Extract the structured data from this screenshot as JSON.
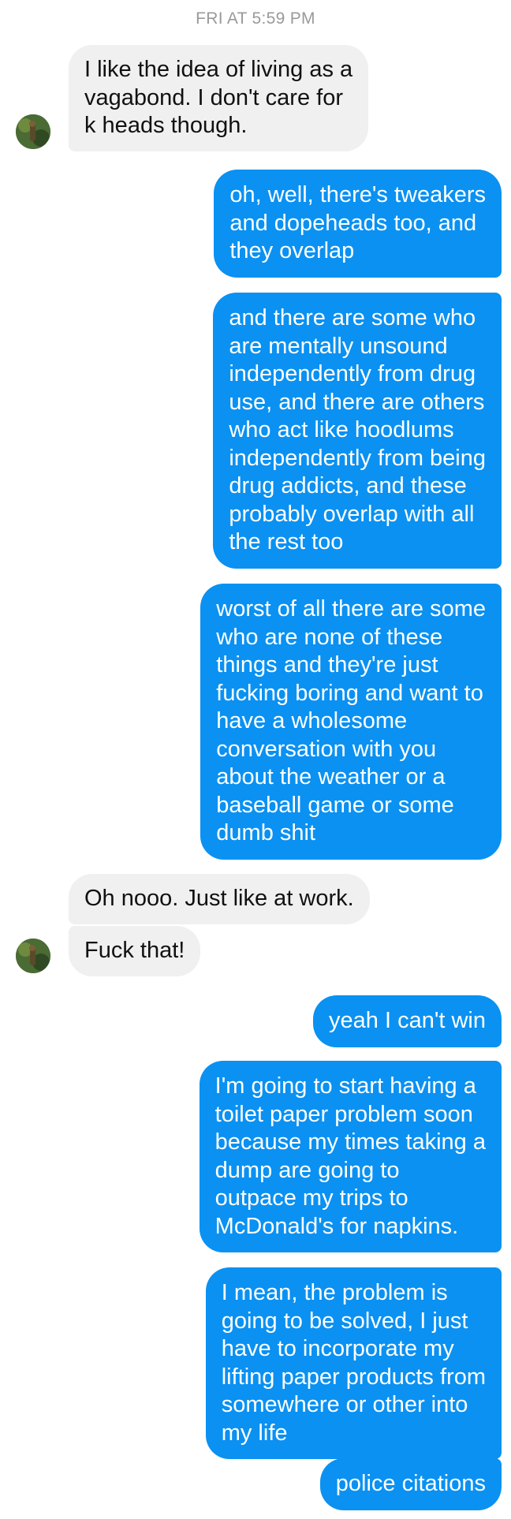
{
  "timestamp": "FRI AT 5:59 PM",
  "colors": {
    "incoming_bubble": "#f0f0f0",
    "outgoing_bubble": "#0a91f2",
    "timestamp_text": "#9a9a9a"
  },
  "messages": [
    {
      "direction": "incoming",
      "text": "I like the idea of living as a\nvagabond. I don't care for\nk heads though."
    },
    {
      "direction": "outgoing",
      "text": "oh, well, there's tweakers\nand dopeheads too, and\nthey overlap"
    },
    {
      "direction": "outgoing",
      "text": "and there are some who\nare mentally unsound\nindependently from drug\nuse, and there are others\nwho act like hoodlums\nindependently from being\ndrug addicts, and these\nprobably overlap with all\nthe rest too"
    },
    {
      "direction": "outgoing",
      "text": "worst of all there are some\nwho are none of these\nthings and they're just\nfucking boring and want to\nhave a wholesome\nconversation with you\nabout the weather or a\nbaseball game or some\ndumb shit"
    },
    {
      "direction": "incoming",
      "text": "Oh nooo. Just like at work."
    },
    {
      "direction": "incoming",
      "text": "Fuck that!"
    },
    {
      "direction": "outgoing",
      "text": "yeah I can't win"
    },
    {
      "direction": "outgoing",
      "text": "I'm going to start having a\ntoilet paper problem soon\nbecause my times taking a\ndump are going to\noutpace my trips to\nMcDonald's for napkins."
    },
    {
      "direction": "outgoing",
      "text": "I mean, the problem is\ngoing to be solved, I just\nhave to incorporate my\nlifting paper products from\nsomewhere or other into\nmy life"
    },
    {
      "direction": "outgoing",
      "text": "police citations"
    }
  ],
  "avatars": [
    {
      "icon": "contact-avatar-icon"
    },
    {
      "icon": "contact-avatar-icon"
    }
  ]
}
